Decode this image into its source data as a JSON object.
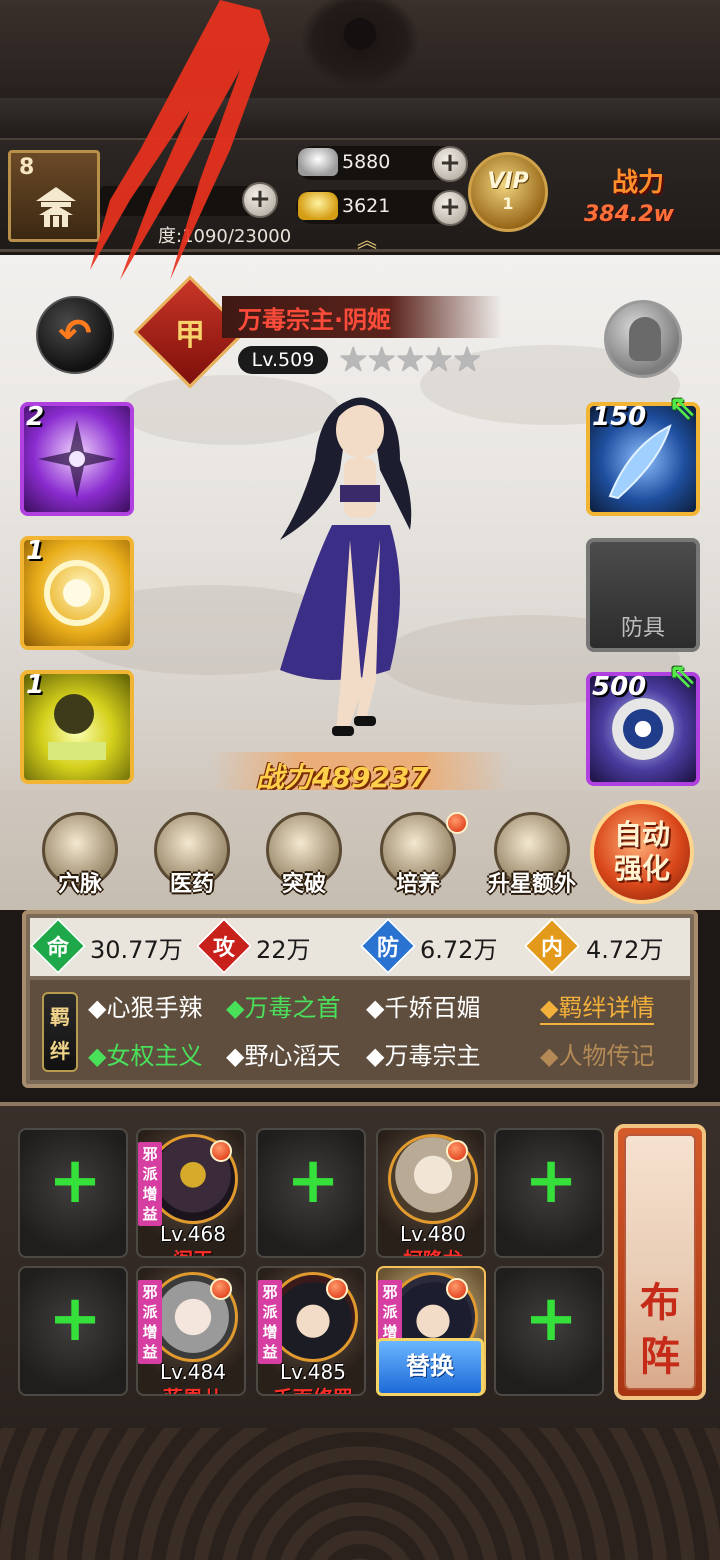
{
  "top_bar": {
    "player_level": "8",
    "exp_progress": "1090/23000",
    "exp_prefix": "度:",
    "silver": "5880",
    "gold": "3621",
    "vip_label": "VIP",
    "vip_level": "1",
    "power_label": "战力",
    "power_value": "384.2w",
    "expand_icon": "chevron-up-icon"
  },
  "hero": {
    "rank_badge": "甲",
    "name": "万毒宗主·阴姬",
    "level": "Lv.509",
    "stars": "★★★★★",
    "power": "战力489237"
  },
  "skills": [
    {
      "count": "2",
      "icon": "shuriken-skill-icon"
    },
    {
      "count": "1",
      "icon": "golden-swirl-skill-icon"
    },
    {
      "count": "1",
      "icon": "poison-skill-icon"
    }
  ],
  "equipment": [
    {
      "count": "150",
      "icon": "blade-weapon-icon"
    },
    {
      "count": "",
      "label": "防具",
      "icon": "armor-empty-icon"
    },
    {
      "count": "500",
      "icon": "yinyang-accessory-icon"
    }
  ],
  "actions": [
    {
      "label": "穴脉",
      "icon": "meridian-icon"
    },
    {
      "label": "医药",
      "icon": "medicine-icon"
    },
    {
      "label": "突破",
      "icon": "breakthrough-icon"
    },
    {
      "label": "培养",
      "icon": "training-scroll-icon"
    },
    {
      "label": "升星额外",
      "icon": "star-up-icon"
    }
  ],
  "auto_enhance": {
    "line1": "自动",
    "line2": "强化"
  },
  "stats": [
    {
      "icon": "命",
      "value": "30.77万",
      "color": "#1fa84a"
    },
    {
      "icon": "攻",
      "value": "22万",
      "color": "#c8201a"
    },
    {
      "icon": "防",
      "value": "6.72万",
      "color": "#2a73d0"
    },
    {
      "icon": "内",
      "value": "4.72万",
      "color": "#e39a1a"
    }
  ],
  "bonds": {
    "badge": "羁绊",
    "row1": [
      {
        "text": "◆心狠手辣",
        "active": false
      },
      {
        "text": "◆万毒之首",
        "active": true
      },
      {
        "text": "◆千娇百媚",
        "active": false
      }
    ],
    "row2": [
      {
        "text": "◆女权主义",
        "active": true
      },
      {
        "text": "◆野心滔天",
        "active": false
      },
      {
        "text": "◆万毒宗主",
        "active": false
      }
    ],
    "detail_link": "◆羁绊详情",
    "bio_link": "◆人物传记"
  },
  "team": {
    "tag": "邪派增益",
    "heroes": [
      {
        "level": "Lv.468",
        "name": "阎王"
      },
      {
        "level": "Lv.480",
        "name": "柯降龙"
      },
      {
        "level": "Lv.484",
        "name": "蓝凰儿"
      },
      {
        "level": "Lv.485",
        "name": "千面修罗"
      }
    ],
    "replace_label": "替换",
    "formation_label": "布阵"
  }
}
